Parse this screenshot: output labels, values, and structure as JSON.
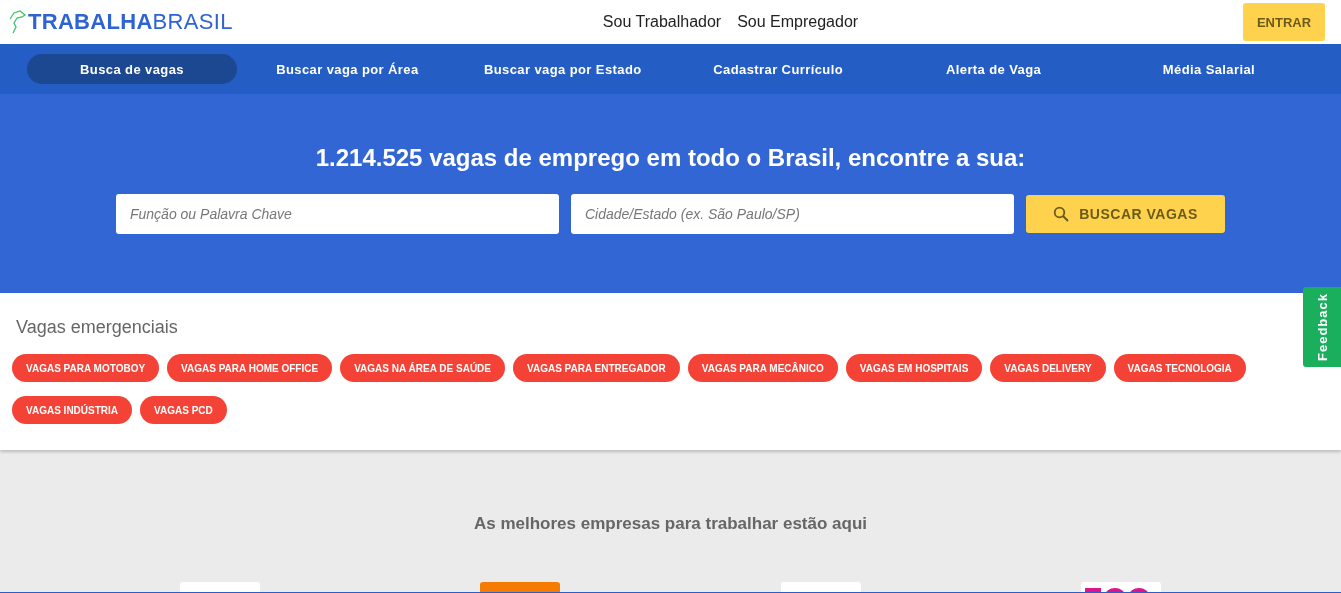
{
  "header": {
    "logo": "**TRABALHA**BRASIL",
    "links": [
      "Sou Trabalhador",
      "Sou Empregador"
    ],
    "login_button": "ENTRAR"
  },
  "nav": [
    {
      "label": "Busca de vagas",
      "selected": true
    },
    {
      "label": "Buscar vaga por Área",
      "selected": false
    },
    {
      "label": "Buscar vaga por Estado",
      "selected": false
    },
    {
      "label": "Cadastrar Currículo",
      "selected": false
    },
    {
      "label": "Alerta de Vaga",
      "selected": false
    },
    {
      "label": "Média Salarial",
      "selected": false
    }
  ],
  "hero": {
    "title": "1.214.525 vagas de emprego em todo o Brasil, encontre a sua:",
    "keyword_field": {
      "placeholder": "Função ou Palavra Chave"
    },
    "location_field": {
      "placeholder": "Cidade/Estado (ex. São Paulo/SP)"
    },
    "search_button": "BUSCAR VAGAS"
  },
  "emergency": {
    "title": "Vagas emergenciais",
    "tags": [
      "VAGAS PARA MOTOBOY",
      "VAGAS PARA HOME OFFICE",
      "VAGAS NA ÁREA DE SAÚDE",
      "VAGAS PARA ENTREGADOR",
      "VAGAS PARA MECÂNICO",
      "VAGAS EM HOSPITAIS",
      "VAGAS DELIVERY",
      "VAGAS TECNOLOGIA",
      "VAGAS INDÚSTRIA",
      "VAGAS PCD"
    ]
  },
  "companies": {
    "title": "As melhores empresas para trabalhar estão aqui"
  },
  "feedback_tab": "Feedback"
}
